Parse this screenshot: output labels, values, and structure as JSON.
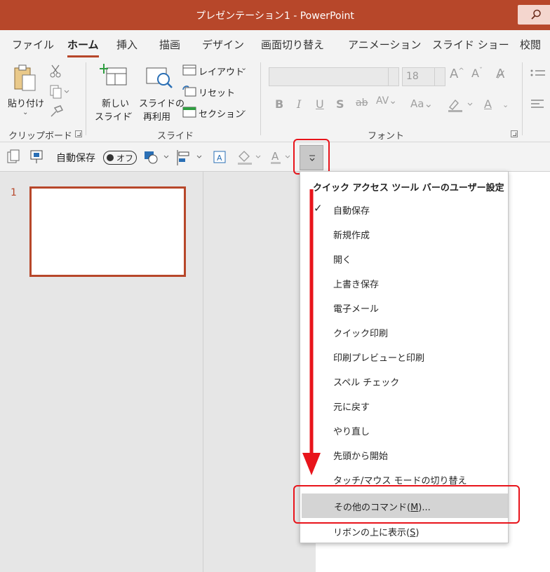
{
  "window": {
    "title": "プレゼンテーション1  -  PowerPoint"
  },
  "tabs": [
    "ファイル",
    "ホーム",
    "挿入",
    "描画",
    "デザイン",
    "画面切り替え",
    "アニメーション",
    "スライド ショー",
    "校閲"
  ],
  "ribbon": {
    "clipboard": {
      "paste_label": "貼り付け",
      "group_label": "クリップボード"
    },
    "slides": {
      "new_slide_line1": "新しい",
      "new_slide_line2": "スライド",
      "reuse_line1": "スライドの",
      "reuse_line2": "再利用",
      "layout": "レイアウト",
      "reset": "リセット",
      "section": "セクション",
      "group_label": "スライド"
    },
    "font": {
      "size": "18",
      "group_label": "フォント"
    }
  },
  "qat": {
    "autosave_label": "自動保存",
    "autosave_state": "オフ"
  },
  "slide_panel": {
    "slide_number": "1"
  },
  "menu": {
    "title": "クイック アクセス ツール バーのユーザー設定",
    "items": [
      {
        "label": "自動保存",
        "checked": true
      },
      {
        "label": "新規作成"
      },
      {
        "label": "開く"
      },
      {
        "label": "上書き保存"
      },
      {
        "label": "電子メール"
      },
      {
        "label": "クイック印刷"
      },
      {
        "label": "印刷プレビューと印刷"
      },
      {
        "label": "スペル チェック"
      },
      {
        "label": "元に戻す"
      },
      {
        "label": "やり直し"
      },
      {
        "label": "先頭から開始"
      },
      {
        "label": "タッチ/マウス モードの切り替え"
      }
    ],
    "more_commands": {
      "pre": "その他のコマンド(",
      "key": "M",
      "post": ")..."
    },
    "show_above": {
      "pre": "リボンの上に表示(",
      "key": "S",
      "post": ")"
    }
  },
  "colors": {
    "accent": "#b7472a",
    "highlight": "#e8141b",
    "menu_hover": "#d4d4d4"
  }
}
